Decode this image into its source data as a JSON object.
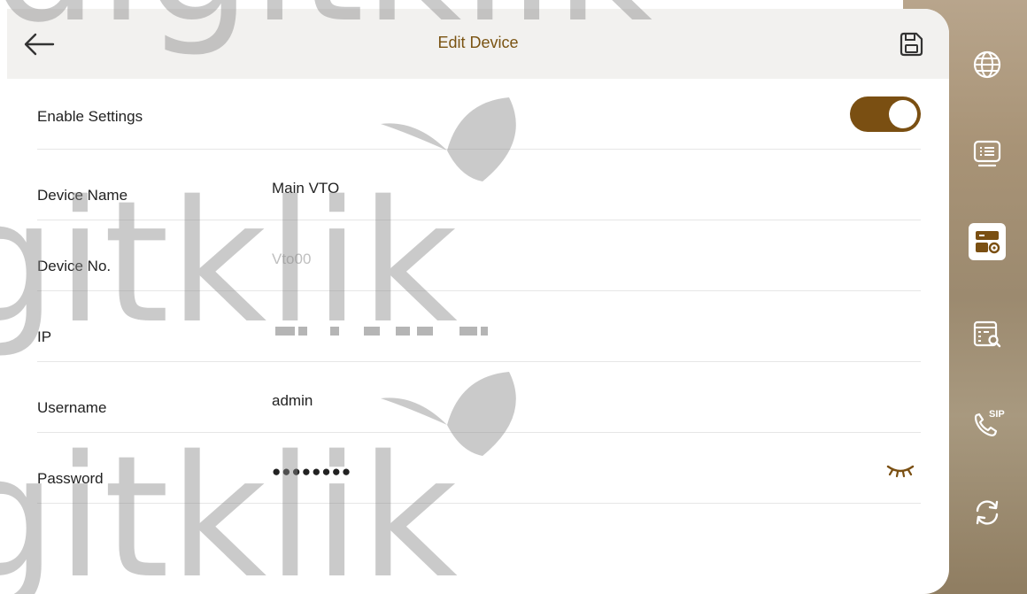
{
  "header": {
    "title": "Edit Device"
  },
  "rows": [
    {
      "label": "Enable Settings",
      "value": ""
    },
    {
      "label": "Device Name",
      "value": "Main VTO"
    },
    {
      "label": "Device No.",
      "value": "Vto00"
    },
    {
      "label": "IP",
      "value": ""
    },
    {
      "label": "Username",
      "value": "admin"
    },
    {
      "label": "Password",
      "value": "●●●●●●●●"
    }
  ],
  "enable_settings": {
    "on": true
  },
  "watermark": {
    "text": "digitklik"
  },
  "sidebar": {
    "items": [
      {
        "icon": "globe-icon"
      },
      {
        "icon": "list-icon"
      },
      {
        "icon": "device-settings-icon",
        "active": true
      },
      {
        "icon": "record-search-icon"
      },
      {
        "icon": "sip-call-icon",
        "text": "SIP"
      },
      {
        "icon": "sync-icon"
      }
    ]
  },
  "colors": {
    "accent": "#7a4f12",
    "title": "#7a5312",
    "header_bg": "#f2f1ef"
  }
}
